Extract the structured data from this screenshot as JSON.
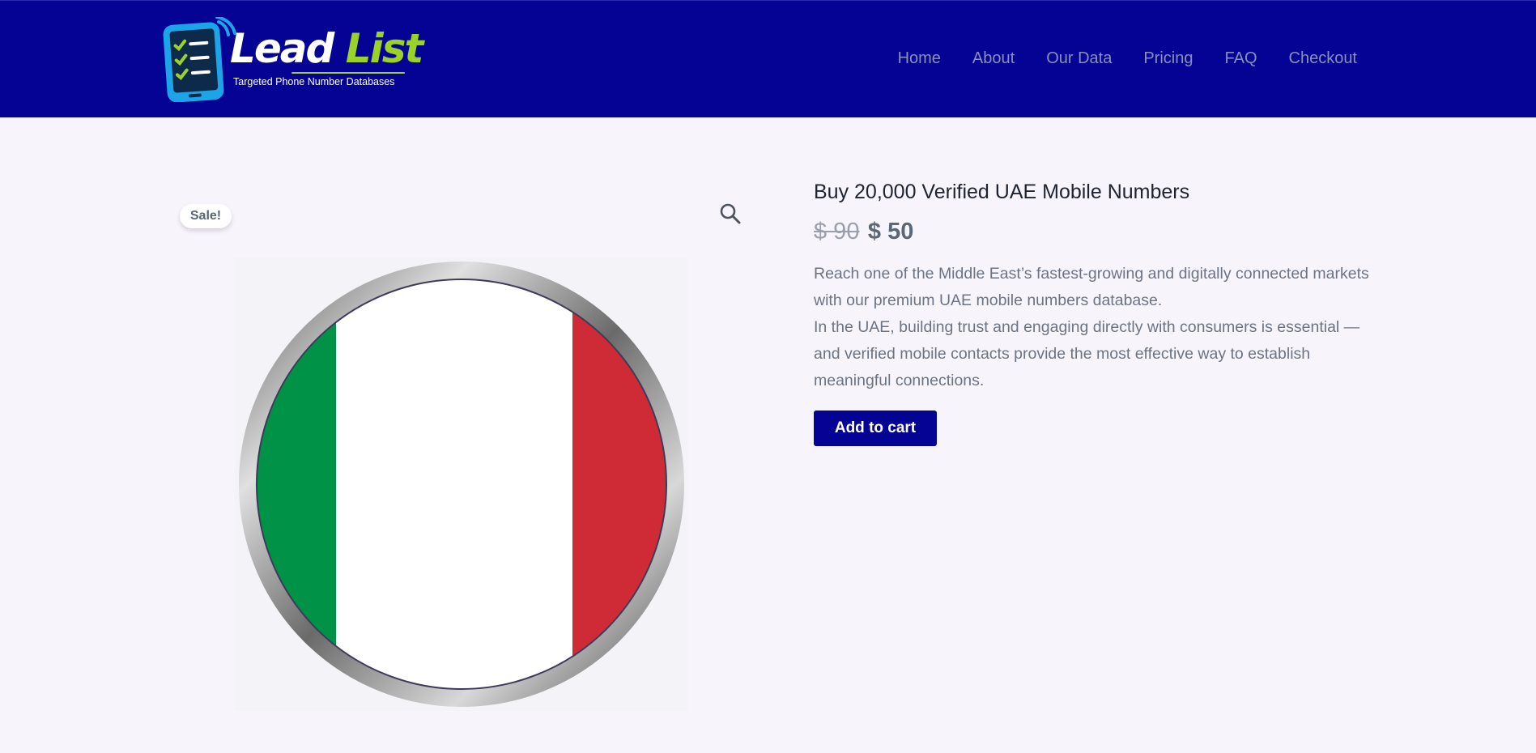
{
  "header": {
    "logo": {
      "word1": "Lead",
      "word2": "List",
      "tagline": "Targeted Phone Number Databases",
      "icon": "phone-checklist-icon",
      "colors": {
        "primary": "#1ca3e8",
        "accent": "#9bd227"
      }
    },
    "nav": [
      {
        "label": "Home"
      },
      {
        "label": "About"
      },
      {
        "label": "Our Data"
      },
      {
        "label": "Pricing"
      },
      {
        "label": "FAQ"
      },
      {
        "label": "Checkout"
      }
    ],
    "background": "#040393"
  },
  "product": {
    "sale_badge": "Sale!",
    "zoom_icon": "magnifier-icon",
    "image": {
      "description_icon": "italy-flag-button",
      "colors": {
        "green": "#009246",
        "white": "#ffffff",
        "red": "#ce2b37"
      }
    },
    "title": "Buy 20,000 Verified UAE Mobile Numbers",
    "price_old": "$ 90",
    "price_new": "$ 50",
    "description": [
      "Reach one of the Middle East’s fastest-growing and digitally connected markets with our premium UAE mobile numbers database.",
      "In the UAE, building trust and engaging directly with consumers is essential — and verified mobile contacts provide the most effective way to establish meaningful connections."
    ],
    "add_to_cart_label": "Add to cart"
  }
}
